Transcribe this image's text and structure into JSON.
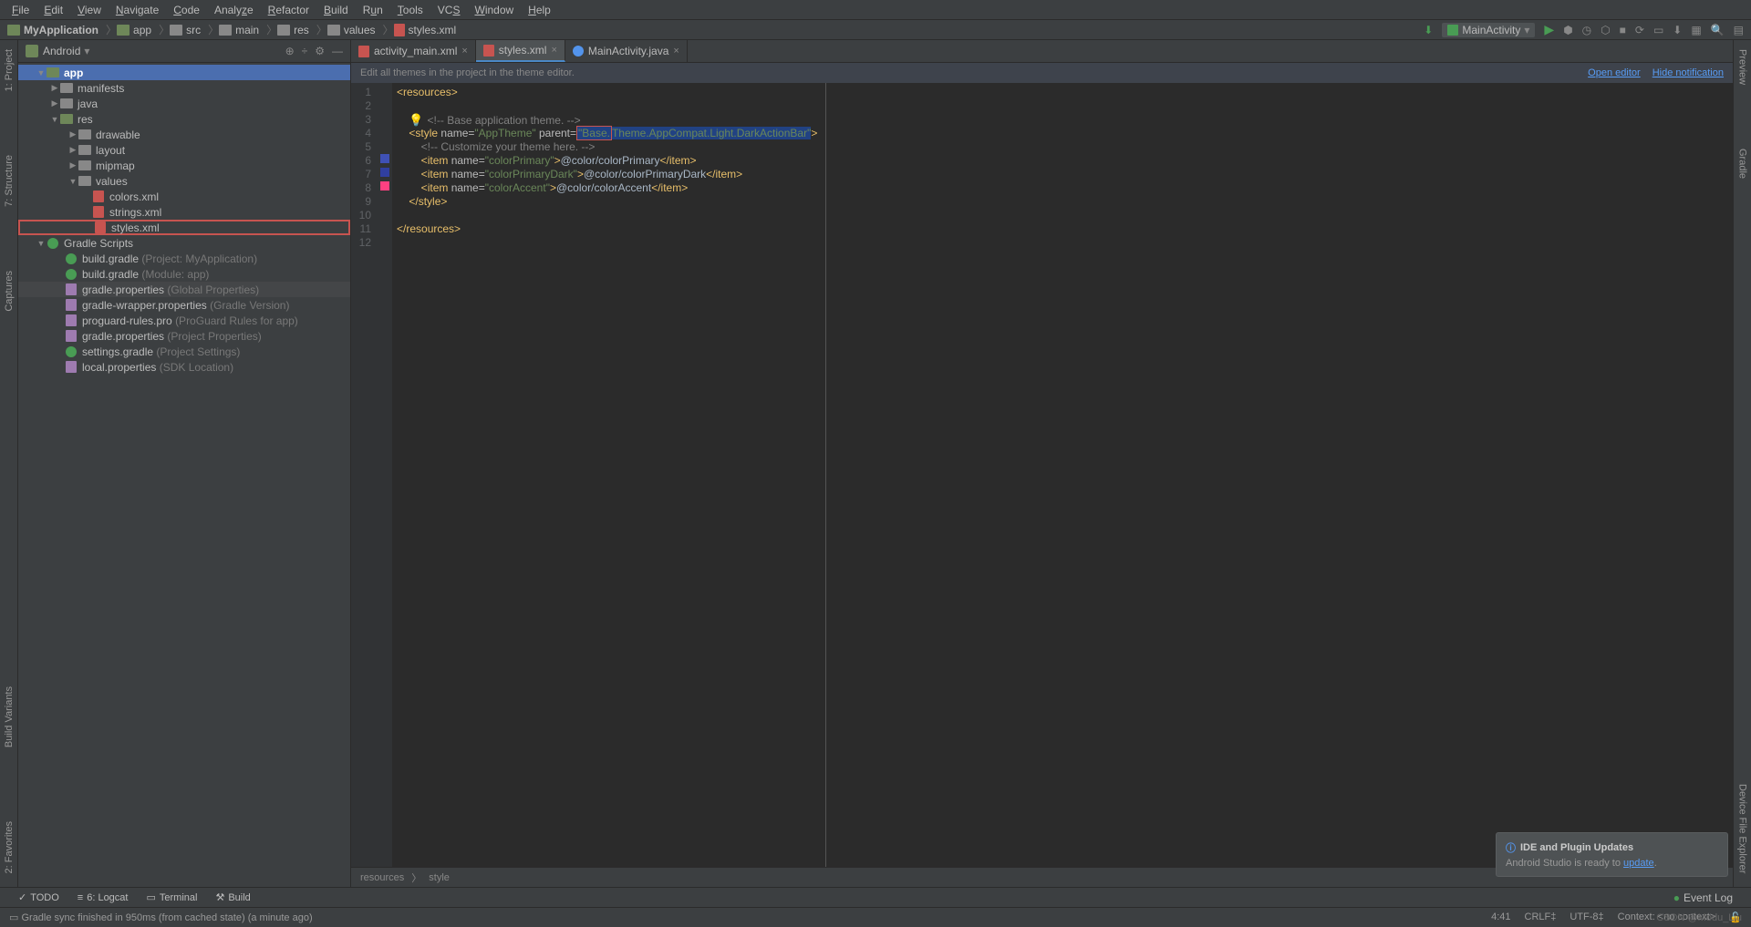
{
  "menubar": [
    "File",
    "Edit",
    "View",
    "Navigate",
    "Code",
    "Analyze",
    "Refactor",
    "Build",
    "Run",
    "Tools",
    "VCS",
    "Window",
    "Help"
  ],
  "navbar": {
    "crumbs": [
      "MyApplication",
      "app",
      "src",
      "main",
      "res",
      "values",
      "styles.xml"
    ],
    "run_config": "MainActivity"
  },
  "panel": {
    "title": "Android",
    "tree": {
      "app": "app",
      "manifests": "manifests",
      "java": "java",
      "res": "res",
      "drawable": "drawable",
      "layout": "layout",
      "mipmap": "mipmap",
      "values": "values",
      "colors": "colors.xml",
      "strings": "strings.xml",
      "styles": "styles.xml",
      "gradle_scripts": "Gradle Scripts",
      "bg1": "build.gradle",
      "bg1_hint": "(Project: MyApplication)",
      "bg2": "build.gradle",
      "bg2_hint": "(Module: app)",
      "gp": "gradle.properties",
      "gp_hint": "(Global Properties)",
      "gw": "gradle-wrapper.properties",
      "gw_hint": "(Gradle Version)",
      "pg": "proguard-rules.pro",
      "pg_hint": "(ProGuard Rules for app)",
      "gp2": "gradle.properties",
      "gp2_hint": "(Project Properties)",
      "sg": "settings.gradle",
      "sg_hint": "(Project Settings)",
      "lp": "local.properties",
      "lp_hint": "(SDK Location)"
    }
  },
  "tabs": [
    {
      "label": "activity_main.xml",
      "type": "xml"
    },
    {
      "label": "styles.xml",
      "type": "xml",
      "active": true
    },
    {
      "label": "MainActivity.java",
      "type": "java"
    }
  ],
  "hintbar": {
    "text": "Edit all themes in the project in the theme editor.",
    "link1": "Open editor",
    "link2": "Hide notification"
  },
  "code": {
    "line_nums": [
      "1",
      "2",
      "3",
      "4",
      "5",
      "6",
      "7",
      "8",
      "9",
      "10",
      "11",
      "12"
    ],
    "l1": "resources",
    "l3_cmt": "<!-- Base application theme. -->",
    "l4_style": "style",
    "l4_name_attr": "name=",
    "l4_name_val": "\"AppTheme\"",
    "l4_parent": " parent=",
    "l4_pv1": "\"Base.",
    "l4_pv2": "Theme.AppCompat.Light.DarkActionBar\"",
    "l5_cmt": "<!-- Customize your theme here. -->",
    "l6_item": "item",
    "l6_name": "name=",
    "l6_nv": "\"colorPrimary\"",
    "l6_txt": "@color/colorPrimary",
    "l7_nv": "\"colorPrimaryDark\"",
    "l7_txt": "@color/colorPrimaryDark",
    "l8_nv": "\"colorAccent\"",
    "l8_txt": "@color/colorAccent",
    "l9": "style",
    "l11": "resources"
  },
  "breadcrumbs": [
    "resources",
    "style"
  ],
  "left_tabs": [
    "1: Project",
    "7: Structure",
    "Captures",
    "Build Variants",
    "2: Favorites"
  ],
  "right_tabs": [
    "Preview",
    "Gradle",
    "Device File Explorer"
  ],
  "bottom_tabs": [
    "TODO",
    "6: Logcat",
    "Terminal",
    "Build"
  ],
  "event_log": "Event Log",
  "statusbar": {
    "msg": "Gradle sync finished in 950ms (from cached state) (a minute ago)",
    "pos": "4:41",
    "sep": "CRLF",
    "enc": "UTF-8",
    "ctx": "Context: <no context>"
  },
  "notification": {
    "title": "IDE and Plugin Updates",
    "body": "Android Studio is ready to ",
    "link": "update"
  },
  "watermark": "CSDN @Modu_Liu"
}
